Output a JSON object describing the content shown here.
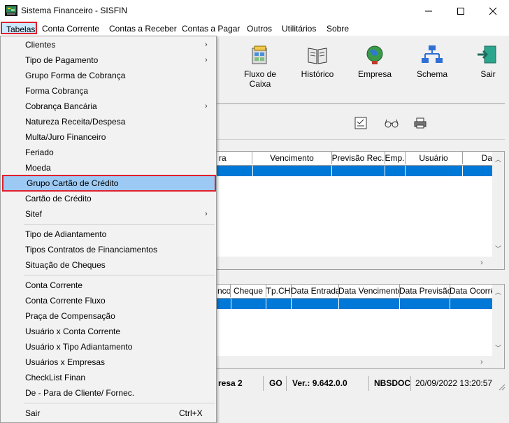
{
  "window": {
    "title": "Sistema Financeiro - SISFIN"
  },
  "menubar": {
    "items": [
      "Tabelas",
      "Conta Corrente",
      "Contas a Receber",
      "Contas a Pagar",
      "Outros",
      "Utilitários",
      "Sobre"
    ]
  },
  "toolbar": {
    "buttons": [
      "Fluxo de Caixa",
      "Histórico",
      "Empresa",
      "Schema",
      "Sair"
    ]
  },
  "grid1": {
    "headers": [
      "ra",
      "Vencimento",
      "Previsão Rec.",
      "Emp.",
      "Usuário",
      "Da"
    ]
  },
  "grid2": {
    "headers": [
      "nco",
      "Cheque",
      "Tp.CH",
      "Data Entrada",
      "Data Vencimento",
      "Data Previsão",
      "Data Ocorrê"
    ]
  },
  "statusbar": {
    "empresa": "resa 2",
    "uf": "GO",
    "version": "Ver.: 9.642.0.0",
    "db": "NBSDOC",
    "datetime": "20/09/2022 13:20:57"
  },
  "dropdown": {
    "items": [
      {
        "label": "Clientes",
        "submenu": true
      },
      {
        "label": "Tipo de Pagamento",
        "submenu": true
      },
      {
        "label": "Grupo Forma de Cobrança"
      },
      {
        "label": "Forma Cobrança"
      },
      {
        "label": "Cobrança Bancária",
        "submenu": true
      },
      {
        "label": "Natureza Receita/Despesa"
      },
      {
        "label": "Multa/Juro Financeiro"
      },
      {
        "label": "Feriado"
      },
      {
        "label": "Moeda"
      },
      {
        "label": "Grupo Cartão de Crédito",
        "highlighted": true
      },
      {
        "label": "Cartão de Crédito"
      },
      {
        "label": "Sitef",
        "submenu": true
      },
      {
        "label": "Tipo de Adiantamento"
      },
      {
        "label": "Tipos Contratos de Financiamentos"
      },
      {
        "label": "Situação de Cheques"
      },
      {
        "label": "Conta Corrente"
      },
      {
        "label": "Conta Corrente Fluxo"
      },
      {
        "label": "Praça de Compensação"
      },
      {
        "label": "Usuário x Conta Corrente"
      },
      {
        "label": "Usuário x Tipo Adiantamento"
      },
      {
        "label": "Usuários x Empresas"
      },
      {
        "label": "CheckList Finan"
      },
      {
        "label": "De - Para de Cliente/ Fornec."
      },
      {
        "label": "Sair",
        "shortcut": "Ctrl+X"
      }
    ],
    "submenu_glyph": "›"
  },
  "colors": {
    "selection": "#0078d7",
    "highlight": "#9ccaf4",
    "annotation": "#e0202d"
  }
}
